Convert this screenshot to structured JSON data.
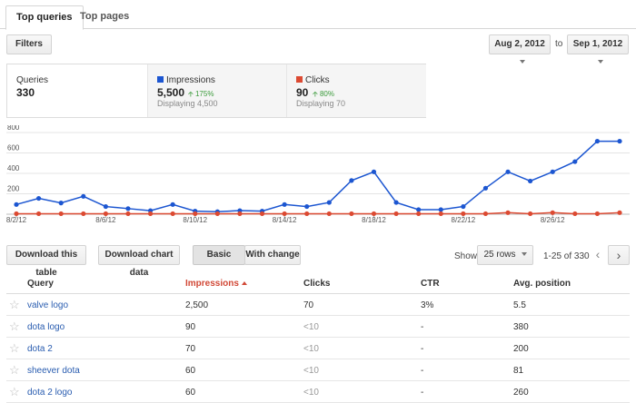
{
  "tabs": [
    {
      "label": "Top queries",
      "active": true
    },
    {
      "label": "Top pages",
      "active": false
    }
  ],
  "filters_label": "Filters",
  "date_range": {
    "start": "Aug 2, 2012",
    "to_label": "to",
    "end": "Sep 1, 2012"
  },
  "summary": {
    "queries": {
      "label": "Queries",
      "value": "330"
    },
    "impressions": {
      "label": "Impressions",
      "value": "5,500",
      "change": "175%",
      "sub": "Displaying 4,500",
      "color": "#1c56d1"
    },
    "clicks": {
      "label": "Clicks",
      "value": "90",
      "change": "80%",
      "sub": "Displaying 70",
      "color": "#dc4a32"
    }
  },
  "chart_data": {
    "type": "line",
    "x": [
      "8/2/12",
      "8/3/12",
      "8/4/12",
      "8/5/12",
      "8/6/12",
      "8/7/12",
      "8/8/12",
      "8/9/12",
      "8/10/12",
      "8/11/12",
      "8/12/12",
      "8/13/12",
      "8/14/12",
      "8/15/12",
      "8/16/12",
      "8/17/12",
      "8/18/12",
      "8/19/12",
      "8/20/12",
      "8/21/12",
      "8/22/12",
      "8/23/12",
      "8/24/12",
      "8/25/12",
      "8/26/12",
      "8/27/12",
      "8/28/12",
      "8/29/12"
    ],
    "x_tick_labels": [
      "8/2/12",
      "8/6/12",
      "8/10/12",
      "8/14/12",
      "8/18/12",
      "8/22/12",
      "8/26/12"
    ],
    "y_ticks": [
      200,
      400,
      600,
      800
    ],
    "ylim": [
      0,
      800
    ],
    "grid": true,
    "series": [
      {
        "name": "Impressions",
        "color": "#1c56d1",
        "values": [
          95,
          155,
          110,
          175,
          75,
          55,
          35,
          95,
          30,
          25,
          35,
          30,
          95,
          75,
          115,
          330,
          415,
          115,
          45,
          45,
          75,
          255,
          415,
          325,
          415,
          515,
          715,
          715
        ]
      },
      {
        "name": "Clicks",
        "color": "#dc4a32",
        "values": [
          5,
          5,
          5,
          5,
          5,
          5,
          5,
          5,
          5,
          5,
          5,
          5,
          5,
          5,
          5,
          5,
          5,
          5,
          5,
          5,
          5,
          5,
          15,
          5,
          15,
          5,
          5,
          15
        ]
      }
    ]
  },
  "toolbar": {
    "download_table": "Download this table",
    "download_chart": "Download chart data",
    "basic": "Basic",
    "with_change": "With change",
    "show_label": "Show",
    "rows_select": "25 rows",
    "page_info": "1-25 of 330"
  },
  "table": {
    "headers": [
      "Query",
      "Impressions",
      "Clicks",
      "CTR",
      "Avg. position"
    ],
    "rows": [
      {
        "query": "valve logo",
        "impressions": "2,500",
        "clicks": "70",
        "ctr": "3%",
        "position": "5.5"
      },
      {
        "query": "dota logo",
        "impressions": "90",
        "clicks": "<10",
        "ctr": "-",
        "position": "380"
      },
      {
        "query": "dota 2",
        "impressions": "70",
        "clicks": "<10",
        "ctr": "-",
        "position": "200"
      },
      {
        "query": "sheever dota",
        "impressions": "60",
        "clicks": "<10",
        "ctr": "-",
        "position": "81"
      },
      {
        "query": "dota 2 logo",
        "impressions": "60",
        "clicks": "<10",
        "ctr": "-",
        "position": "260"
      }
    ]
  }
}
